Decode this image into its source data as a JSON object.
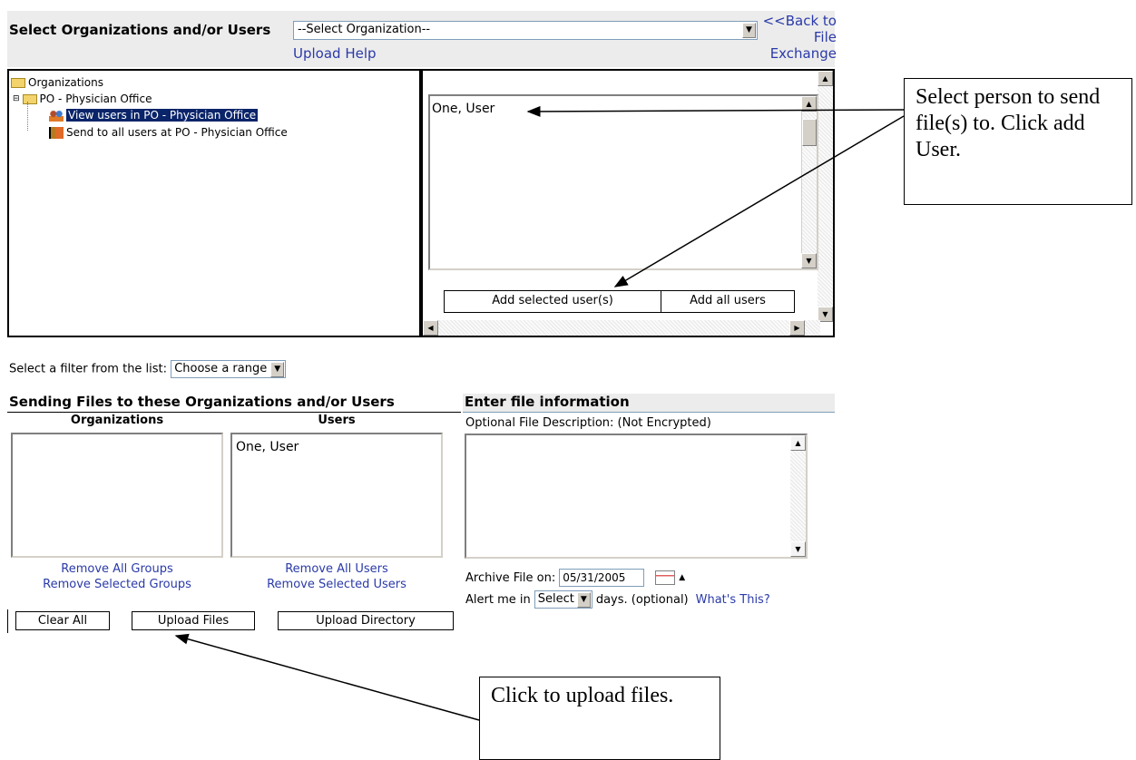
{
  "header": {
    "title": "Select Organizations and/or Users",
    "org_select_value": "--Select Organization--",
    "upload_help": "Upload Help",
    "back_link": "<<Back to File Exchange"
  },
  "tree": {
    "root": "Organizations",
    "org": "PO - Physician Office",
    "view_users": "View users in PO - Physician Office",
    "send_all": "Send to all users at PO - Physician Office"
  },
  "user_list": {
    "items": [
      "One, User"
    ],
    "add_selected": "Add selected user(s)",
    "add_all": "Add all users"
  },
  "filter": {
    "label": "Select a filter from the list:",
    "value": "Choose a range"
  },
  "sending": {
    "heading": "Sending Files to these Organizations and/or Users",
    "organizations_header": "Organizations",
    "users_header": "Users",
    "users": [
      "One, User"
    ],
    "remove_all_groups": "Remove All Groups",
    "remove_selected_groups": "Remove Selected Groups",
    "remove_all_users": "Remove All Users",
    "remove_selected_users": "Remove Selected Users"
  },
  "buttons": {
    "clear_all": "Clear All",
    "upload_files": "Upload Files",
    "upload_directory": "Upload Directory"
  },
  "file_info": {
    "heading": "Enter file information",
    "description_label": "Optional File Description: (Not Encrypted)",
    "archive_label": "Archive File on:",
    "archive_date": "05/31/2005",
    "alert_prefix": "Alert me in",
    "alert_value": "Select",
    "alert_suffix": "days. (optional)",
    "whats_this": "What's This?"
  },
  "callouts": {
    "select_person": "Select person to send file(s) to. Click add User.",
    "upload": "Click to upload files."
  }
}
